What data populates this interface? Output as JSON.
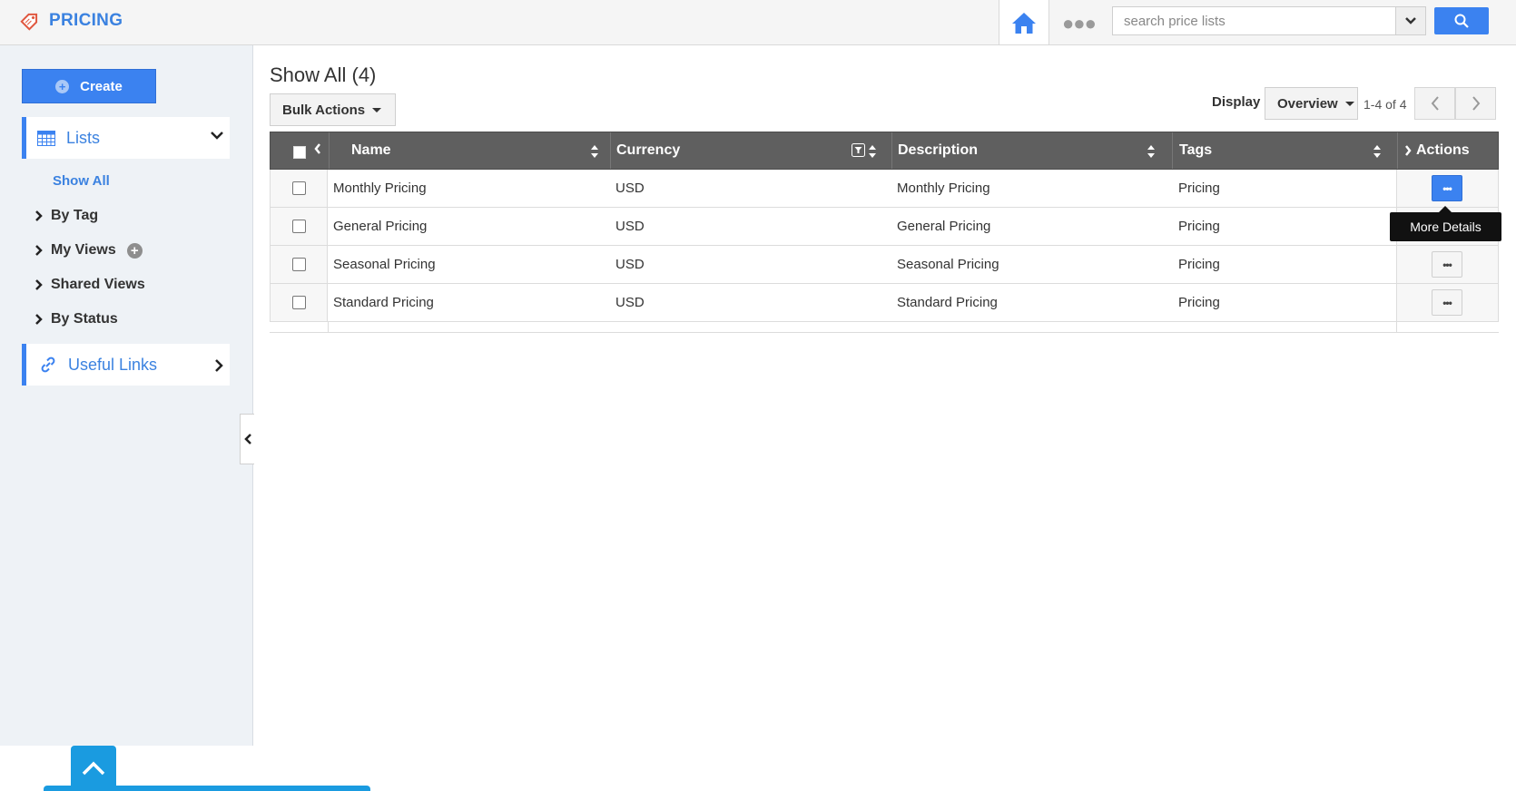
{
  "app": {
    "title": "PRICING",
    "brand_color": "#3b82e0",
    "accent_color": "#3b82f0"
  },
  "header": {
    "home_icon": "home-icon",
    "more_icon": "more-horizontal-icon",
    "search": {
      "placeholder": "search price lists",
      "value": ""
    },
    "search_button_icon": "search-icon"
  },
  "sidebar": {
    "create_label": "Create",
    "lists_label": "Lists",
    "show_all_label": "Show All",
    "nav_items": [
      {
        "label": "By Tag"
      },
      {
        "label": "My Views"
      },
      {
        "label": "Shared Views"
      },
      {
        "label": "By Status"
      }
    ],
    "useful_links_label": "Useful Links"
  },
  "main": {
    "page_title": "Show All (4)",
    "bulk_actions_label": "Bulk Actions",
    "display_label": "Display",
    "display_value": "Overview",
    "page_count": "1-4 of 4",
    "table": {
      "columns": [
        "Name",
        "Currency",
        "Description",
        "Tags",
        "Actions"
      ],
      "rows": [
        {
          "name": "Monthly Pricing",
          "currency": "USD",
          "description": "Monthly Pricing",
          "tags": "Pricing"
        },
        {
          "name": "General Pricing",
          "currency": "USD",
          "description": "General Pricing",
          "tags": "Pricing"
        },
        {
          "name": "Seasonal Pricing",
          "currency": "USD",
          "description": "Seasonal Pricing",
          "tags": "Pricing"
        },
        {
          "name": "Standard Pricing",
          "currency": "USD",
          "description": "Standard Pricing",
          "tags": "Pricing"
        }
      ],
      "action_button_label": "•••",
      "tooltip": "More Details"
    }
  }
}
